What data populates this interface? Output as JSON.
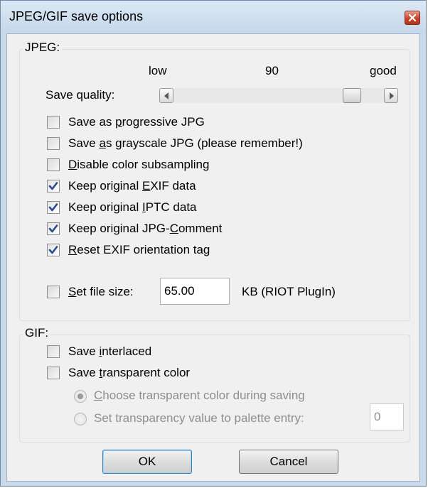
{
  "window": {
    "title": "JPEG/GIF save options"
  },
  "jpeg": {
    "group_label": "JPEG:",
    "slider": {
      "low_label": "low",
      "value_label": "90",
      "good_label": "good",
      "row_label_pre": "Save quality:",
      "value": 90,
      "fraction": 0.88
    },
    "options": [
      {
        "pre": "Save as ",
        "key": "p",
        "post": "rogressive JPG",
        "checked": false
      },
      {
        "pre": "Save ",
        "key": "a",
        "post": "s grayscale JPG (please remember!)",
        "checked": false
      },
      {
        "pre": "",
        "key": "D",
        "post": "isable color subsampling",
        "checked": false
      },
      {
        "pre": "Keep original ",
        "key": "E",
        "post": "XIF data",
        "checked": true
      },
      {
        "pre": "Keep original ",
        "key": "I",
        "post": "PTC data",
        "checked": true
      },
      {
        "pre": "Keep original JPG-",
        "key": "C",
        "post": "omment",
        "checked": true
      },
      {
        "pre": "",
        "key": "R",
        "post": "eset EXIF orientation tag",
        "checked": true
      }
    ],
    "file_size": {
      "pre": "",
      "key": "S",
      "post": "et file size:",
      "checked": false,
      "value": "65.00",
      "unit_label": "KB (RIOT PlugIn)"
    }
  },
  "gif": {
    "group_label": "GIF:",
    "interlaced": {
      "pre": "Save ",
      "key": "i",
      "post": "nterlaced",
      "checked": false
    },
    "transparent": {
      "pre": "Save ",
      "key": "t",
      "post": "ransparent color",
      "checked": false
    },
    "radio_choose": {
      "pre": "",
      "key": "C",
      "post": "hoose transparent color during saving",
      "selected": true
    },
    "radio_palette": {
      "label": "Set transparency value to palette entry:",
      "selected": false,
      "value": "0"
    }
  },
  "buttons": {
    "ok_label": "OK",
    "cancel_label": "Cancel"
  },
  "colors": {
    "checkmark": "#2a4c8f",
    "default_button_border": "#3c7fb1"
  }
}
